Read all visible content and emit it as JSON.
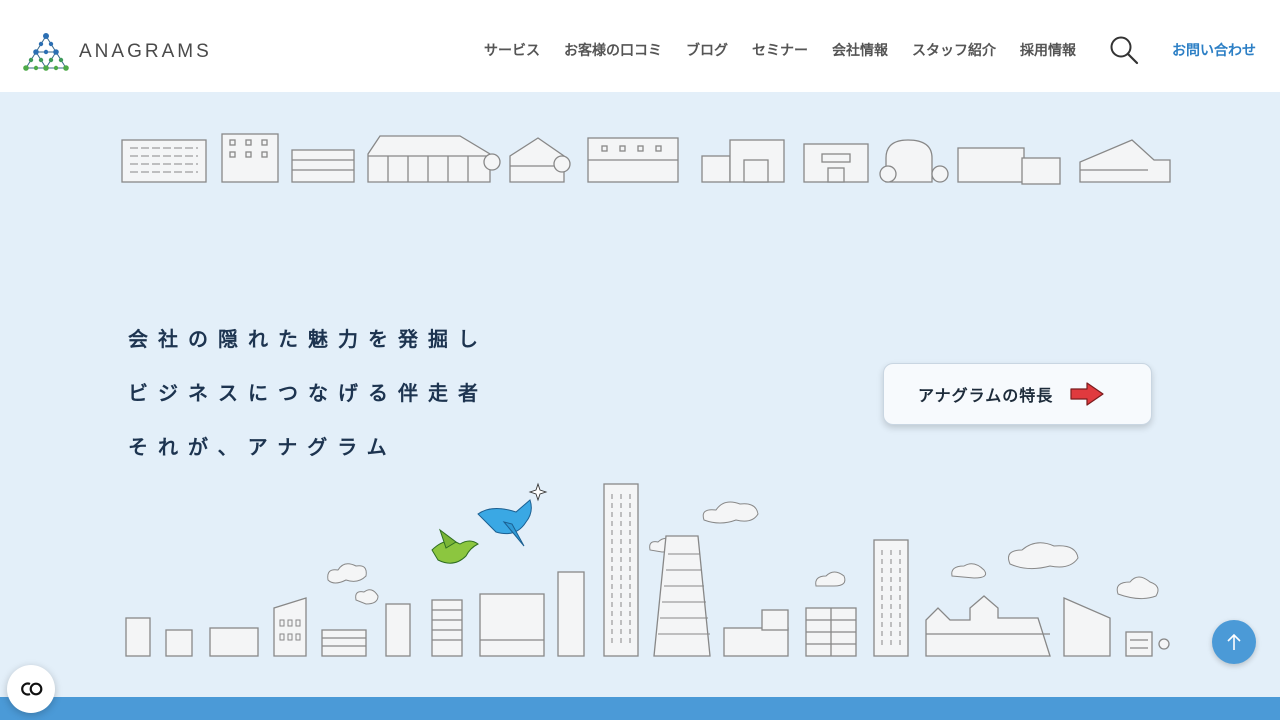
{
  "brand": {
    "name": "ANAGRAMS"
  },
  "nav": {
    "items": [
      "サービス",
      "お客様の口コミ",
      "ブログ",
      "セミナー",
      "会社情報",
      "スタッフ紹介",
      "採用情報"
    ],
    "contact_label": "お問い合わせ"
  },
  "hero": {
    "tagline": [
      "会社の隠れた魅力を発掘し",
      "ビジネスにつなげる伴走者",
      "それが、アナグラム"
    ],
    "feature_button_label": "アナグラムの特長"
  },
  "icons": {
    "search": "search-icon",
    "arrow": "red-arrow-icon",
    "scroll_top": "arrow-up-icon",
    "accessibility": "accessibility-icon"
  },
  "colors": {
    "header_bg": "#ffffff",
    "hero_bg": "#e3eff9",
    "accent_blue": "#4b9ad7",
    "contact_link": "#2c7fc5",
    "tagline_text": "#1d3450",
    "arrow_red": "#e03a3e"
  }
}
